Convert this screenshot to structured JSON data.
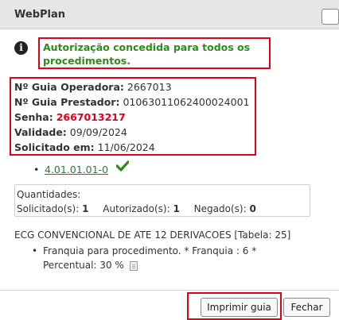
{
  "window": {
    "title": "WebPlan"
  },
  "auth": {
    "icon": "info-icon",
    "message": "Autorização concedida para todos os procedimentos."
  },
  "guide": {
    "operadora_label": "Nº Guia Operadora:",
    "operadora_value": "2667013",
    "prestador_label": "Nº Guia Prestador:",
    "prestador_value": "01063011062400024001",
    "senha_label": "Senha:",
    "senha_value": "2667013217",
    "validade_label": "Validade:",
    "validade_value": "09/09/2024",
    "solicitado_label": "Solicitado em:",
    "solicitado_value": "11/06/2024"
  },
  "procedure": {
    "code": "4.01.01.01-0",
    "icon": "check-icon"
  },
  "quantities": {
    "title": "Quantidades:",
    "solicitado_label": "Solicitado(s):",
    "solicitado_value": "1",
    "autorizado_label": "Autorizado(s):",
    "autorizado_value": "1",
    "negado_label": "Negado(s):",
    "negado_value": "0"
  },
  "exam": {
    "description": "ECG CONVENCIONAL DE ATE 12 DERIVACOES [Tabela: 25]",
    "franquia": "Franquia para procedimento. * Franquia : 6 * Percentual: 30 %",
    "doc_icon": "document-icon"
  },
  "buttons": {
    "print_label": "Imprimir guia",
    "close_label": "Fechar"
  },
  "colors": {
    "highlight": "#e0001b",
    "success": "#2e8b1a"
  }
}
